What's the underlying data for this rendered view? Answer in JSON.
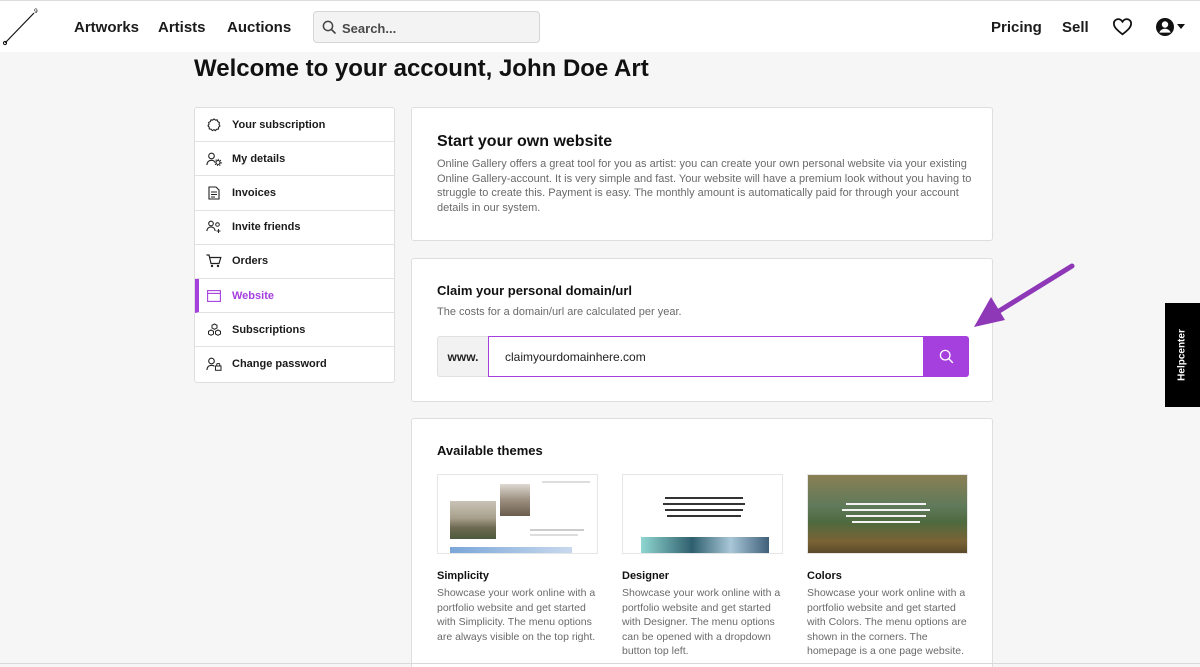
{
  "nav": {
    "links": [
      "Artworks",
      "Artists",
      "Auctions"
    ],
    "search_placeholder": "Search...",
    "right_links": [
      "Pricing",
      "Sell"
    ],
    "icons": [
      "heart-icon",
      "user-icon",
      "caret-down-icon"
    ]
  },
  "page": {
    "title": "Welcome to your account, John Doe Art"
  },
  "sidebar": {
    "items": [
      {
        "label": "Your subscription",
        "icon": "badge-icon"
      },
      {
        "label": "My details",
        "icon": "user-gear-icon"
      },
      {
        "label": "Invoices",
        "icon": "document-icon"
      },
      {
        "label": "Invite friends",
        "icon": "users-add-icon"
      },
      {
        "label": "Orders",
        "icon": "cart-icon"
      },
      {
        "label": "Website",
        "icon": "browser-window-icon",
        "active": true
      },
      {
        "label": "Subscriptions",
        "icon": "cubes-icon"
      },
      {
        "label": "Change password",
        "icon": "user-lock-icon"
      }
    ]
  },
  "website_card": {
    "title": "Start your own website",
    "body": "Online Gallery offers a great tool for you as artist: you can create your own personal website via your existing Online Gallery-account. It is very simple and fast. Your website will have a premium look without you having to struggle to create this. Payment is easy. The monthly amount is automatically paid for through your account details in our system."
  },
  "domain_card": {
    "title": "Claim your personal domain/url",
    "subtitle": "The costs for a domain/url are calculated per year.",
    "prefix": "www.",
    "value": "claimyourdomainhere.com"
  },
  "themes_card": {
    "title": "Available themes",
    "themes": [
      {
        "name": "Simplicity",
        "desc": "Showcase your work online with a portfolio website and get started with Simplicity. The menu options are always visible on the top right."
      },
      {
        "name": "Designer",
        "desc": "Showcase your work online with a portfolio website and get started with Designer. The menu options can be opened with a dropdown button top left."
      },
      {
        "name": "Colors",
        "desc": "Showcase your work online with a portfolio website and get started with Colors. The menu options are shown in the corners. The homepage is a one page website."
      }
    ]
  },
  "helpcenter": {
    "label": "Helpcenter"
  },
  "colors": {
    "accent": "#a53fdd",
    "arrow": "#8e38b8"
  }
}
